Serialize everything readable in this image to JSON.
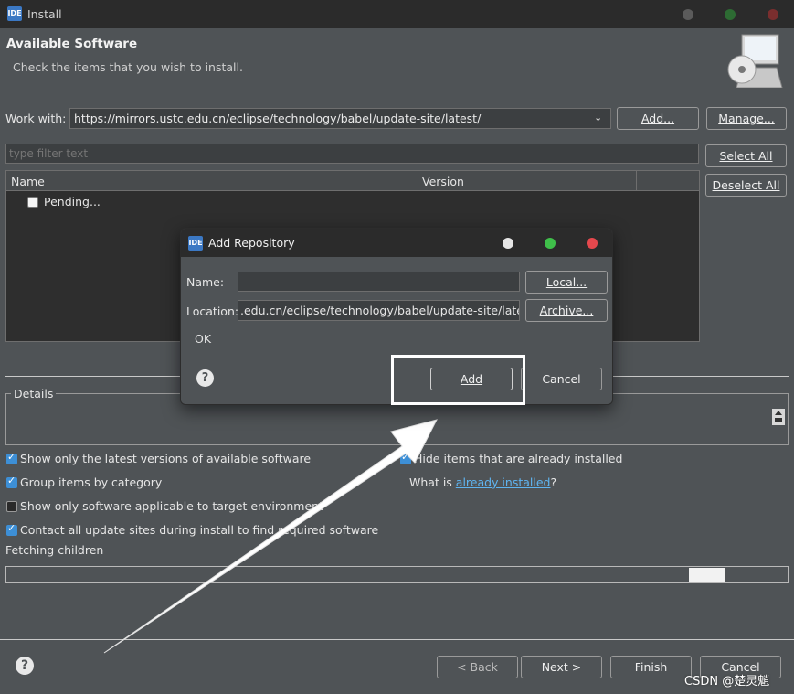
{
  "window": {
    "title": "Install"
  },
  "header": {
    "title": "Available Software",
    "subtitle": "Check the items that you wish to install."
  },
  "work_with": {
    "label": "Work with:",
    "value": "https://mirrors.ustc.edu.cn/eclipse/technology/babel/update-site/latest/",
    "add_label": "Add...",
    "manage_label": "Manage..."
  },
  "filter": {
    "placeholder": "type filter text"
  },
  "buttons": {
    "select_all": "Select All",
    "deselect_all": "Deselect All"
  },
  "table": {
    "columns": [
      "Name",
      "Version"
    ],
    "rows": [
      {
        "name": "Pending...",
        "checked": false
      }
    ]
  },
  "details": {
    "label": "Details"
  },
  "options": {
    "show_latest": "Show only the latest versions of available software",
    "group_by_category": "Group items by category",
    "applicable_only": "Show only software applicable to target environment",
    "contact_update_sites": "Contact all update sites during install to find required software",
    "hide_installed": "Hide items that are already installed",
    "what_is": "What is ",
    "already_installed_link": "already installed",
    "question_mark": "?"
  },
  "status": {
    "fetching": "Fetching children"
  },
  "footer": {
    "back": "< Back",
    "next": "Next >",
    "finish": "Finish",
    "cancel": "Cancel"
  },
  "dialog": {
    "title": "Add Repository",
    "name_label": "Name:",
    "name_value": "",
    "location_label": "Location:",
    "location_value": ".edu.cn/eclipse/technology/babel/update-site/latest/",
    "local_button": "Local...",
    "archive_button": "Archive...",
    "status": "OK",
    "add_button": "Add",
    "cancel_button": "Cancel"
  },
  "watermark": "CSDN @楚灵魈",
  "colors": {
    "accent": "#3d8fd6",
    "link": "#5fb4f0",
    "highlight": "#ffffff"
  }
}
